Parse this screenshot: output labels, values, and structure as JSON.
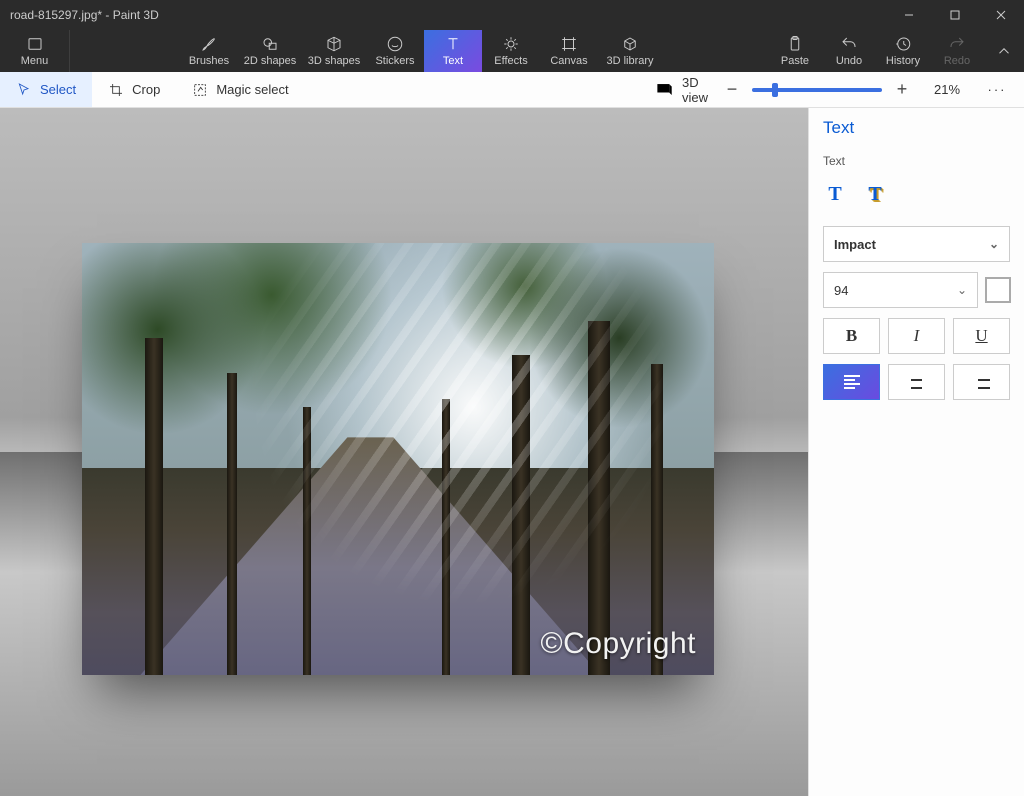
{
  "titlebar": {
    "title": "road-815297.jpg* - Paint 3D"
  },
  "ribbon": {
    "menu": "Menu",
    "tools": {
      "brushes": "Brushes",
      "shapes2d": "2D shapes",
      "shapes3d": "3D shapes",
      "stickers": "Stickers",
      "text": "Text",
      "effects": "Effects",
      "canvas": "Canvas",
      "library3d": "3D library"
    },
    "right": {
      "paste": "Paste",
      "undo": "Undo",
      "history": "History",
      "redo": "Redo"
    }
  },
  "subbar": {
    "select": "Select",
    "crop": "Crop",
    "magic": "Magic select",
    "view3d": "3D view",
    "zoom": "21%"
  },
  "panel": {
    "title": "Text",
    "subheader": "Text",
    "font": "Impact",
    "size": "94",
    "bold": "B",
    "italic": "I",
    "underline": "U",
    "text2d_letter": "T",
    "text3d_letter": "T"
  },
  "canvas": {
    "watermark": "©Copyright"
  }
}
